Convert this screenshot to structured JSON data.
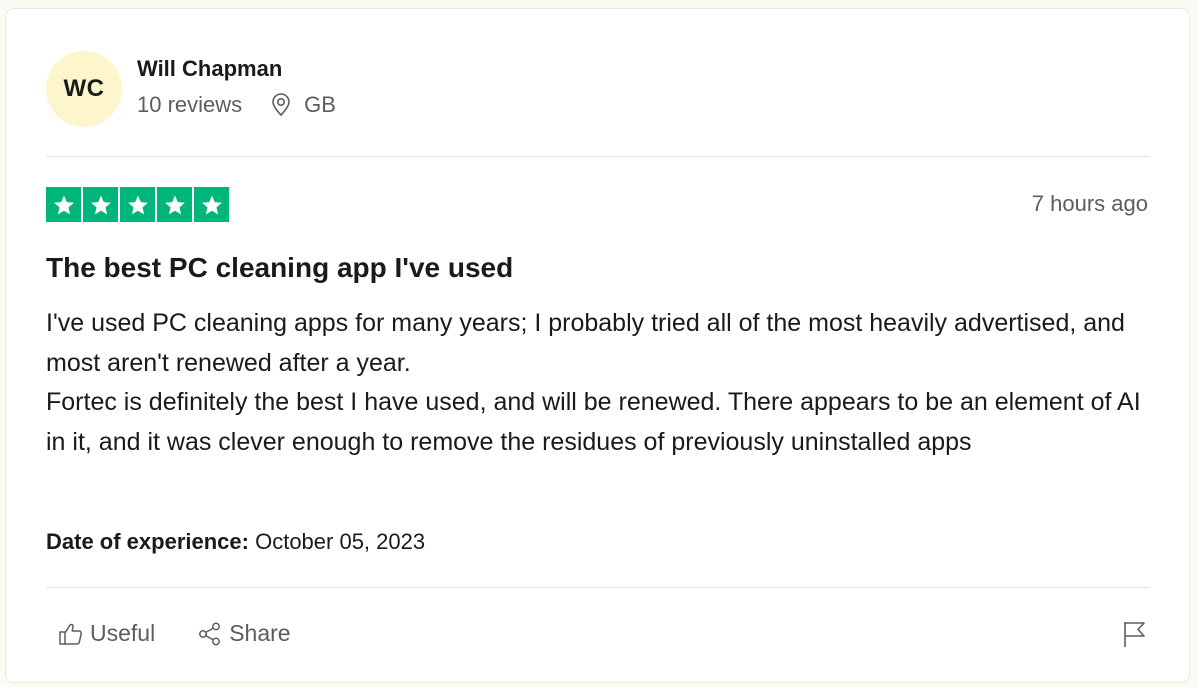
{
  "reviewer": {
    "initials": "WC",
    "name": "Will Chapman",
    "reviews_count": "10 reviews",
    "location": "GB",
    "location_icon": "location-pin-icon"
  },
  "review": {
    "rating": 5,
    "rating_max": 5,
    "star_color": "#00b67a",
    "time_ago": "7 hours ago",
    "title": "The best PC cleaning app I've used",
    "body": [
      "I've used PC cleaning apps for many years; I probably tried all of the most heavily advertised, and most aren't renewed after a year.",
      "Fortec is definitely the best I have used, and will be renewed. There appears to be an element of AI in it, and it was clever enough to remove the residues of previously uninstalled apps"
    ],
    "experience_label": "Date of experience:",
    "experience_date": "October 05, 2023"
  },
  "actions": {
    "useful_label": "Useful",
    "useful_icon": "thumbs-up-icon",
    "share_label": "Share",
    "share_icon": "share-icon",
    "flag_icon": "flag-icon"
  },
  "colors": {
    "avatar_bg": "#fdf6cc",
    "muted_text": "#5d5d5d"
  }
}
